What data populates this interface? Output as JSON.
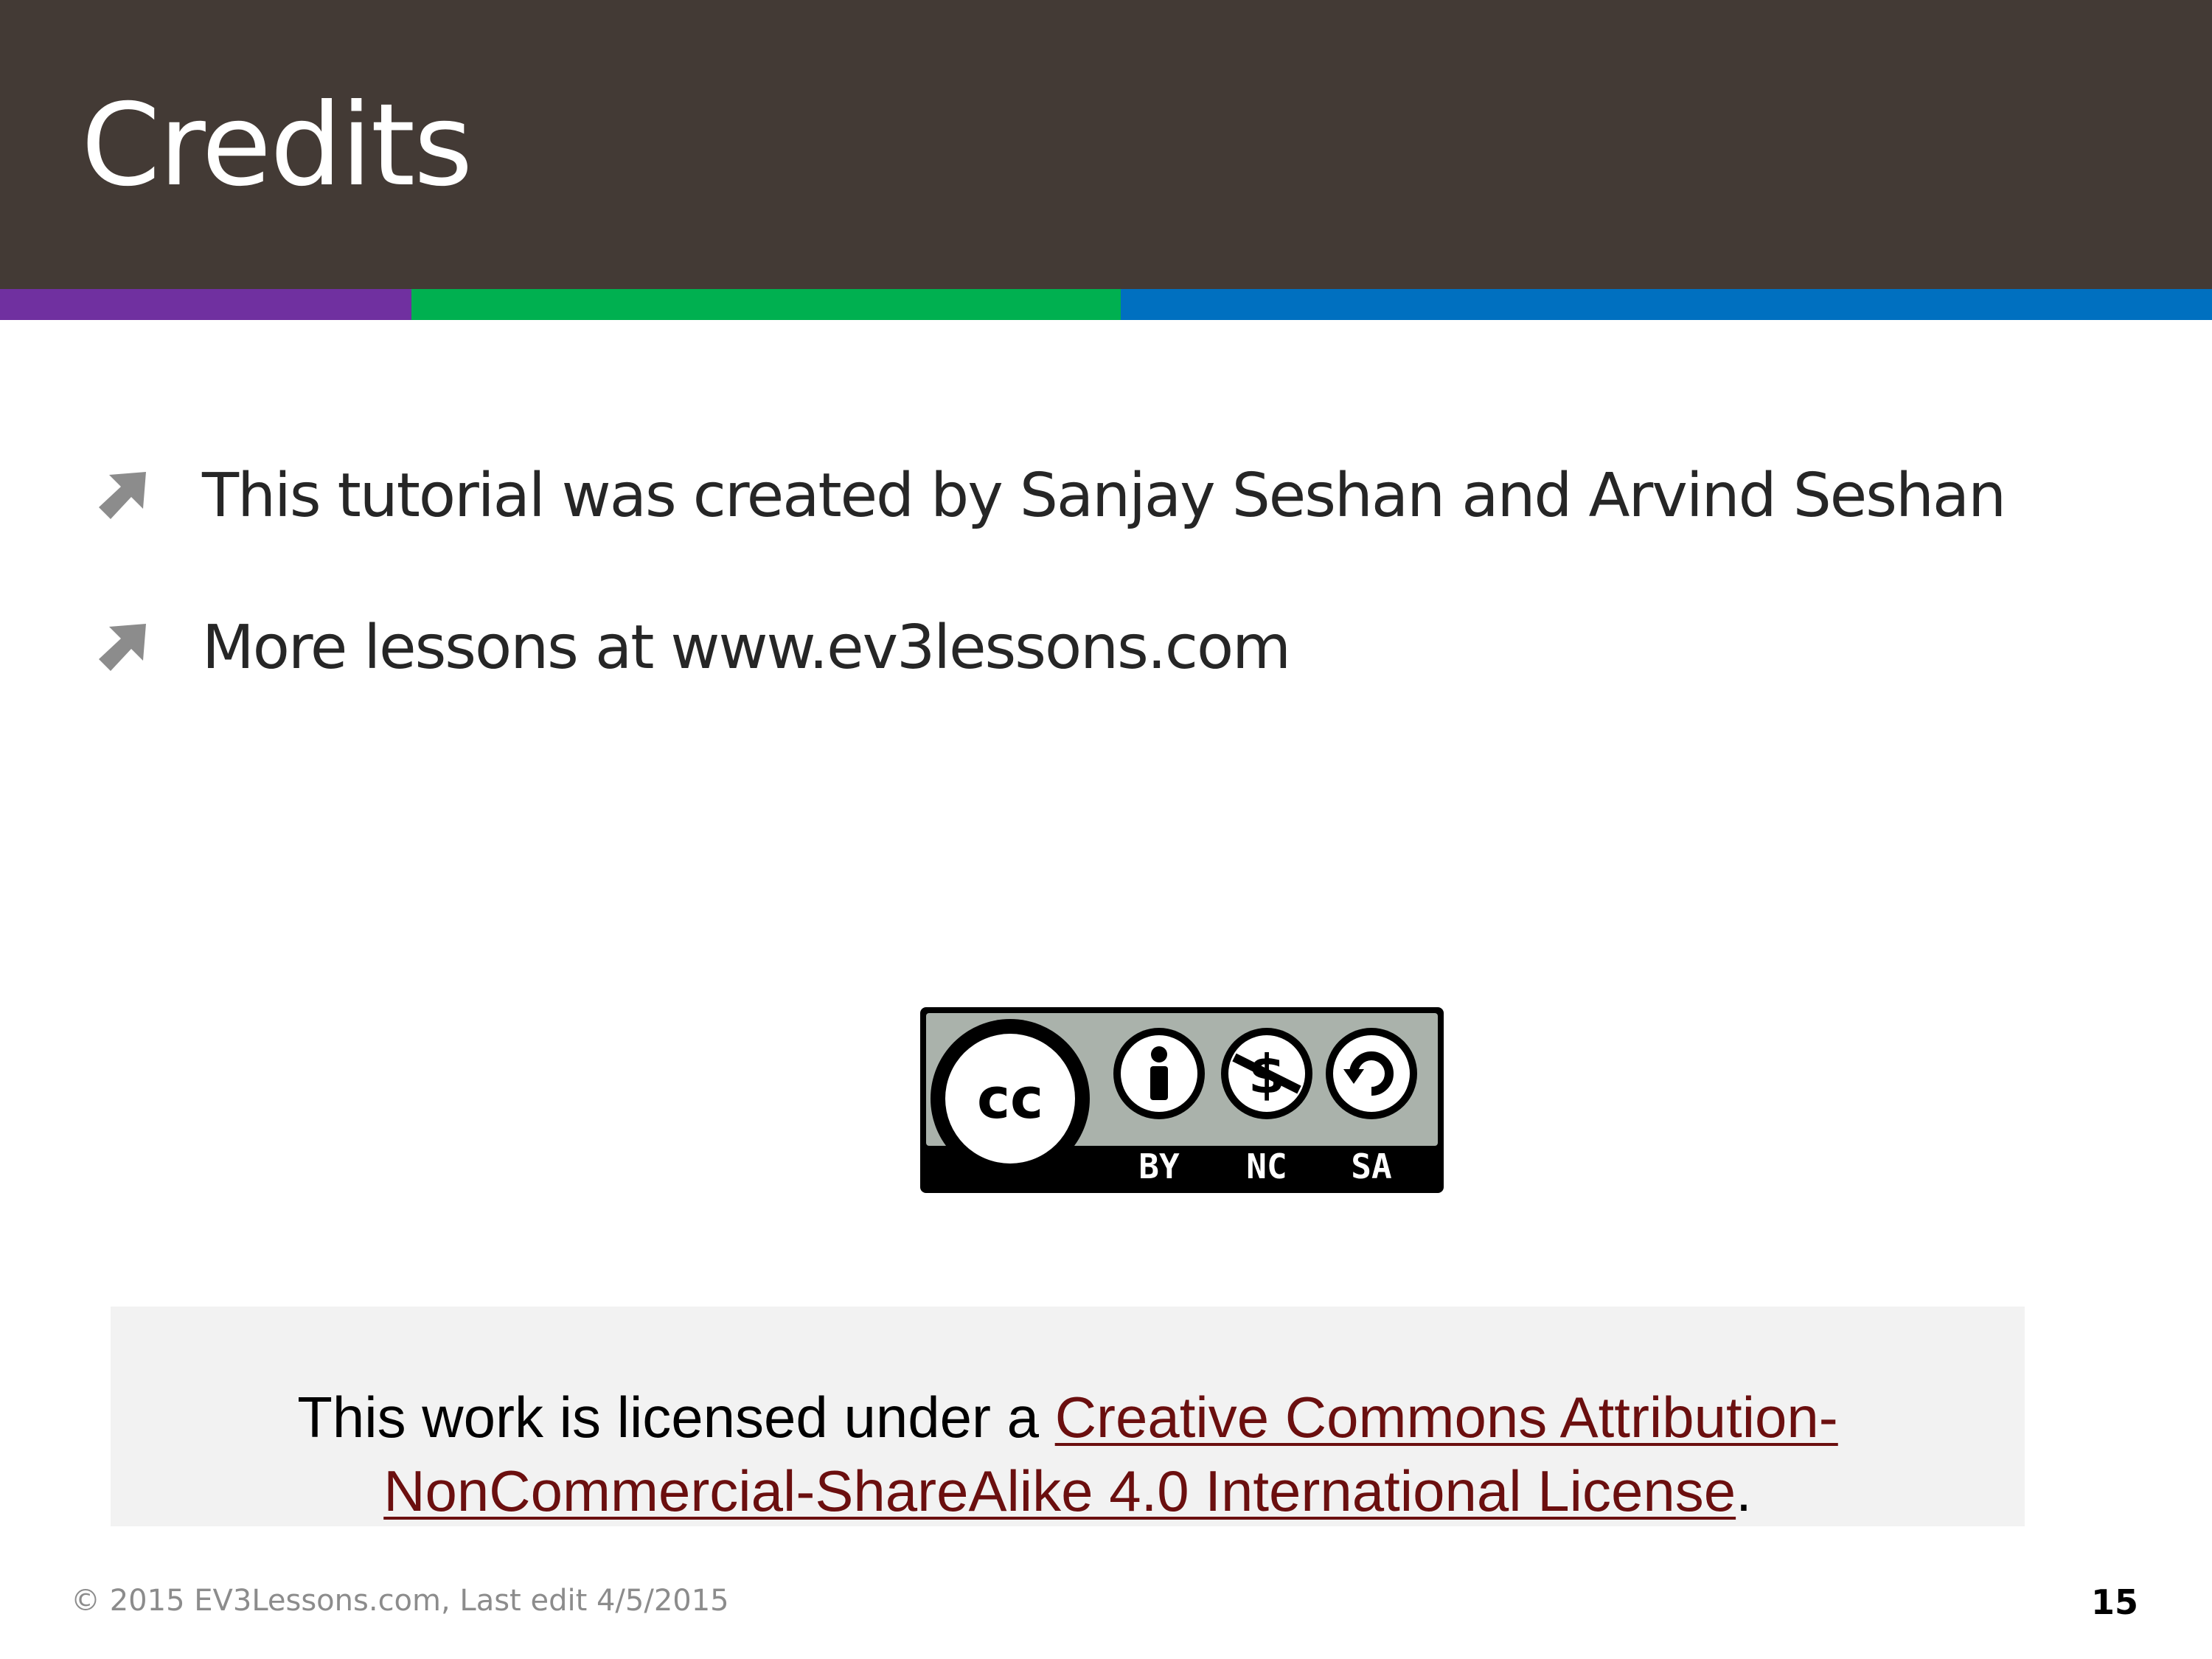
{
  "slide": {
    "title": "Credits"
  },
  "bullets": [
    {
      "text": "This tutorial was created by Sanjay Seshan and Arvind Seshan",
      "icon": "arrow-up-right-icon"
    },
    {
      "text": "More lessons at www.ev3lessons.com",
      "icon": "arrow-up-right-icon"
    }
  ],
  "cc_badge": {
    "main": "cc",
    "labels": [
      "BY",
      "NC",
      "SA"
    ]
  },
  "license": {
    "prefix": "This work is licensed under a ",
    "link_text": "Creative Commons Attribution-NonCommercial-ShareAlike 4.0 International License",
    "suffix": "."
  },
  "footer": {
    "copyright": "© 2015 EV3Lessons.com, Last edit 4/5/2015",
    "page_number": "15"
  },
  "colors": {
    "header": "#433a35",
    "stripe_purple": "#7030a0",
    "stripe_green": "#00b050",
    "stripe_blue": "#0070c0",
    "link": "#6b0f0f"
  }
}
